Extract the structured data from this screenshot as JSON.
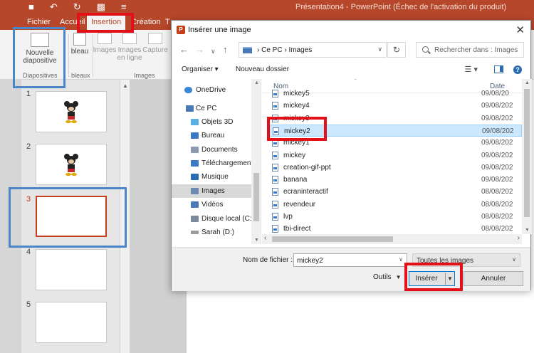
{
  "powerpoint": {
    "window_title": "Présentation4  -  PowerPoint (Échec de l'activation du produit)",
    "tabs": [
      "Fichier",
      "Accueil",
      "Insertion",
      "Création",
      "T"
    ],
    "active_tab": "Insertion",
    "ribbon": {
      "new_slide_label_1": "Nouvelle",
      "new_slide_label_2": "diapositive",
      "group_slides": "Diapositives",
      "table_label": "bleau",
      "group_tables": "bleaux",
      "images_label": "Images",
      "online_images_label_1": "Images",
      "online_images_label_2": "en ligne",
      "capture_label": "Capture",
      "group_images": "Images"
    },
    "slides": [
      {
        "number": "1",
        "has_image": true
      },
      {
        "number": "2",
        "has_image": true
      },
      {
        "number": "3",
        "has_image": false,
        "selected": true
      },
      {
        "number": "4",
        "has_image": false
      },
      {
        "number": "5",
        "has_image": false
      }
    ]
  },
  "dialog": {
    "title": "Insérer une image",
    "close_label": "✕",
    "breadcrumb": "›  Ce PC  ›  Images",
    "search_placeholder": "Rechercher dans : Images",
    "toolbar": {
      "organize": "Organiser  ▾",
      "new_folder": "Nouveau dossier"
    },
    "nav_items": [
      {
        "label": "OneDrive",
        "color": "#3a86d6"
      },
      {
        "label": "Ce PC",
        "color": "#4a7ab5"
      },
      {
        "label": "Objets 3D",
        "color": "#5ab0e0"
      },
      {
        "label": "Bureau",
        "color": "#3c78c8"
      },
      {
        "label": "Documents",
        "color": "#8a9bb0"
      },
      {
        "label": "Téléchargements",
        "color": "#3c78c8"
      },
      {
        "label": "Musique",
        "color": "#2b6cb0"
      },
      {
        "label": "Images",
        "color": "#6d8ab0",
        "selected": true
      },
      {
        "label": "Vidéos",
        "color": "#4a7ab5"
      },
      {
        "label": "Disque local (C:)",
        "color": "#7a8a9a"
      },
      {
        "label": "Sarah (D:)",
        "color": "#9a9a9a"
      }
    ],
    "columns": {
      "name": "Nom",
      "date": "Date"
    },
    "files": [
      {
        "name": "mickey5",
        "date": "09/08/20"
      },
      {
        "name": "mickey4",
        "date": "09/08/202"
      },
      {
        "name": "mickey3",
        "date": "09/08/202"
      },
      {
        "name": "mickey2",
        "date": "09/08/202",
        "selected": true
      },
      {
        "name": "mickey1",
        "date": "09/08/202"
      },
      {
        "name": "mickey",
        "date": "09/08/202"
      },
      {
        "name": "creation-gif-ppt",
        "date": "09/08/202"
      },
      {
        "name": "banana",
        "date": "09/08/202"
      },
      {
        "name": "ecraninteractif",
        "date": "08/08/202"
      },
      {
        "name": "revendeur",
        "date": "08/08/202"
      },
      {
        "name": "lvp",
        "date": "08/08/202"
      },
      {
        "name": "tbi-direct",
        "date": "08/08/202"
      }
    ],
    "filename_label": "Nom de fichier :",
    "filename_value": "mickey2",
    "filter": "Toutes les images",
    "tools": "Outils",
    "insert_button": "Insérer",
    "cancel_button": "Annuler"
  },
  "colors": {
    "powerpoint_accent": "#b7472a",
    "highlight_red": "#e3101a",
    "highlight_blue": "#4a86c8",
    "selection_blue": "#cce8ff"
  }
}
